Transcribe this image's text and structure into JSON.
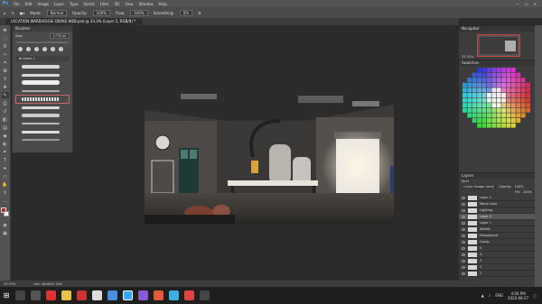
{
  "app": {
    "logo": "Ps",
    "menu": [
      "File",
      "Edit",
      "Image",
      "Layer",
      "Type",
      "Select",
      "Filter",
      "3D",
      "View",
      "Window",
      "Help"
    ],
    "window_controls": [
      "—",
      "☐",
      "✕"
    ]
  },
  "options": {
    "mode_label": "Mode:",
    "mode_value": "Normal",
    "opacity_label": "Opacity:",
    "opacity_value": "100%",
    "flow_label": "Flow:",
    "flow_value": "100%",
    "smoothing_label": "Smoothing:",
    "smoothing_value": "0%"
  },
  "document": {
    "tab_title": "LOCATION WAREHOUSE DRAKE WEB.psd @ 33.3% (Layer 2, RGB/8) *"
  },
  "brushes_panel": {
    "title": "Brushes",
    "size_label": "Size:",
    "size_value": "1778 px",
    "folder_label": "Brushes 1"
  },
  "navigator": {
    "title": "Navigator",
    "zoom": "33.33%"
  },
  "swatches": {
    "title": "Swatches"
  },
  "layers_panel": {
    "title": "Layers",
    "kind_label": "Kind",
    "blend_mode": "Linear Dodge (Add)",
    "opacity_label": "Opacity:",
    "opacity_value": "100%",
    "fill_label": "Fill:",
    "fill_value": "100%",
    "layers": [
      {
        "name": "Layer 1"
      },
      {
        "name": "Warm tone"
      },
      {
        "name": "Lighting"
      },
      {
        "name": "Layer 2"
      },
      {
        "name": "Layer 1"
      },
      {
        "name": "details"
      },
      {
        "name": "Foreground"
      },
      {
        "name": "Group"
      },
      {
        "name": "5"
      },
      {
        "name": "4"
      },
      {
        "name": "3"
      },
      {
        "name": "2"
      },
      {
        "name": "1"
      }
    ]
  },
  "status": {
    "zoom": "33.33%",
    "doc_size": "Doc: 68.8M/1.04G"
  },
  "taskbar": {
    "lang": "ENG",
    "time": "4:06 PM",
    "date": "2020-08-27"
  }
}
